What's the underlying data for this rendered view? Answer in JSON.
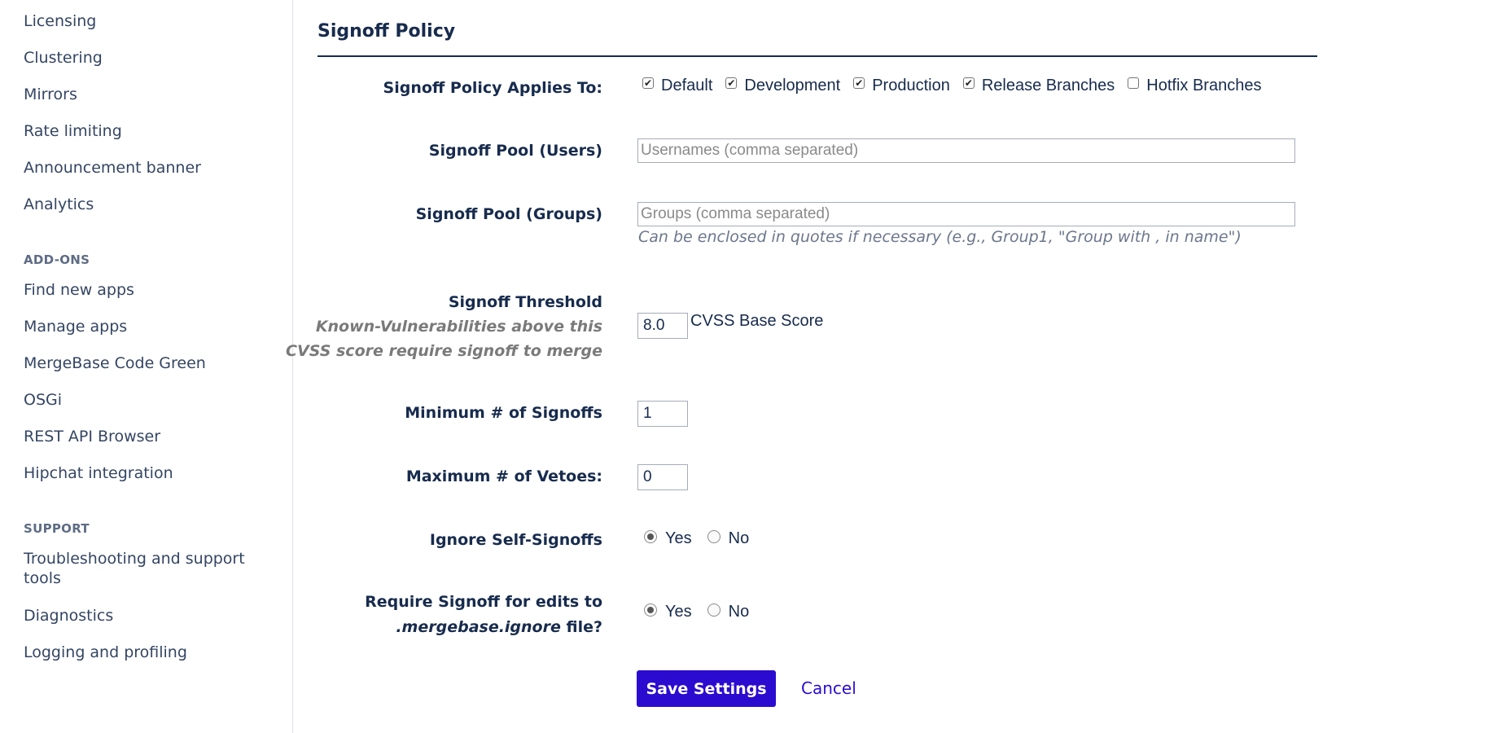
{
  "sidebar": {
    "items_top": [
      {
        "label": "Licensing"
      },
      {
        "label": "Clustering"
      },
      {
        "label": "Mirrors"
      },
      {
        "label": "Rate limiting"
      },
      {
        "label": "Announcement banner"
      },
      {
        "label": "Analytics"
      }
    ],
    "addons_heading": "ADD-ONS",
    "addons_items": [
      {
        "label": "Find new apps"
      },
      {
        "label": "Manage apps"
      },
      {
        "label": "MergeBase Code Green"
      },
      {
        "label": "OSGi"
      },
      {
        "label": "REST API Browser"
      },
      {
        "label": "Hipchat integration"
      }
    ],
    "support_heading": "SUPPORT",
    "support_items": [
      {
        "label_line1": "Troubleshooting and support",
        "label_line2": "tools"
      },
      {
        "label": "Diagnostics"
      },
      {
        "label": "Logging and profiling"
      }
    ]
  },
  "main": {
    "title": "Signoff Policy",
    "applies_to": {
      "label": "Signoff Policy Applies To:",
      "options": [
        {
          "label": "Default",
          "checked": true
        },
        {
          "label": "Development",
          "checked": true
        },
        {
          "label": "Production",
          "checked": true
        },
        {
          "label": "Release Branches",
          "checked": true
        },
        {
          "label": "Hotfix Branches",
          "checked": false
        }
      ]
    },
    "pool_users": {
      "label": "Signoff Pool (Users)",
      "placeholder": "Usernames (comma separated)",
      "value": ""
    },
    "pool_groups": {
      "label": "Signoff Pool (Groups)",
      "placeholder": "Groups (comma separated)",
      "value": "",
      "hint": "Can be enclosed in quotes if necessary (e.g., Group1, \"Group with , in name\")"
    },
    "threshold": {
      "label": "Signoff Threshold",
      "sub_line1": "Known-Vulnerabilities above this",
      "sub_line2": "CVSS score require signoff to merge",
      "value": "8.0",
      "unit": "CVSS Base Score"
    },
    "min_signoffs": {
      "label": "Minimum # of Signoffs",
      "value": "1"
    },
    "max_vetoes": {
      "label": "Maximum # of Vetoes:",
      "value": "0"
    },
    "ignore_self": {
      "label": "Ignore Self-Signoffs",
      "yes": "Yes",
      "no": "No",
      "selected": "Yes"
    },
    "require_ignore": {
      "label_line1": "Require Signoff for edits to",
      "label_file": ".mergebase.ignore",
      "label_suffix": " file?",
      "yes": "Yes",
      "no": "No",
      "selected": "Yes"
    },
    "save_label": "Save Settings",
    "cancel_label": "Cancel",
    "accent_color": "#2c0bd0"
  }
}
